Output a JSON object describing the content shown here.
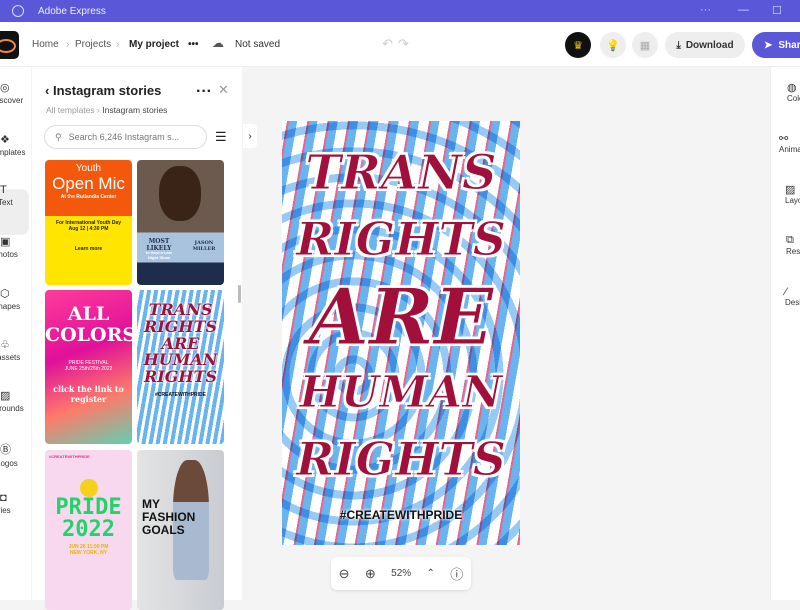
{
  "window": {
    "title": "Adobe Express",
    "controls": [
      "···",
      "—",
      "☐"
    ]
  },
  "topbar": {
    "breadcrumb": [
      "Home",
      "Projects",
      "My project"
    ],
    "more": "•••",
    "save_status": "Not saved",
    "download": "Download",
    "share": "Share"
  },
  "left_rail": [
    {
      "label": "Discover",
      "icon": "compass-icon"
    },
    {
      "label": "Templates",
      "icon": "templates-icon"
    },
    {
      "label": "Text",
      "icon": "text-icon"
    },
    {
      "label": "Photos",
      "icon": "photo-icon"
    },
    {
      "label": "Shapes",
      "icon": "shapes-icon"
    },
    {
      "label": "Design assets",
      "icon": "assets-icon"
    },
    {
      "label": "Backgrounds",
      "icon": "background-icon"
    },
    {
      "label": "Logos",
      "icon": "logo-icon"
    },
    {
      "label": "Libraries",
      "icon": "library-icon"
    }
  ],
  "panel": {
    "title": "Instagram stories",
    "breadcrumb_root": "All templates",
    "breadcrumb_current": "Instagram stories",
    "search_placeholder": "Search 6,246 Instagram s...",
    "templates": [
      {
        "lines": [
          "Youth",
          "Open Mic",
          "At the Rutlandia Center",
          "For International Youth Day",
          "Aug 12 | 4:30 PM",
          "Learn more"
        ]
      },
      {
        "lines": [
          "MOST LIKELY",
          "to Host a Late Night Show",
          "JASON MILLER"
        ]
      },
      {
        "lines": [
          "ALL COLORS",
          "PRIDE FESTIVAL",
          "JUNE 25th/26th 2022",
          "click the link to register"
        ]
      },
      {
        "lines": [
          "TRANS RIGHTS ARE HUMAN RIGHTS",
          "#CREATEWITHPRIDE"
        ]
      },
      {
        "lines": [
          "#CREATEWITHPRIDE",
          "PRIDE 2022",
          "JUN 26 11:00 PM",
          "NEW YORK, NY"
        ]
      },
      {
        "lines": [
          "MY FASHION GOALS"
        ]
      }
    ]
  },
  "canvas": {
    "lines": [
      "TRANS",
      "RIGHTS",
      "ARE",
      "HUMAN",
      "RIGHTS"
    ],
    "hashtag": "#CREATEWITHPRIDE"
  },
  "zoom": {
    "level": "52%"
  },
  "right_rail": [
    {
      "label": "Colors"
    },
    {
      "label": "Animation"
    },
    {
      "label": "Layout"
    },
    {
      "label": "Resize"
    },
    {
      "label": "Design"
    }
  ]
}
